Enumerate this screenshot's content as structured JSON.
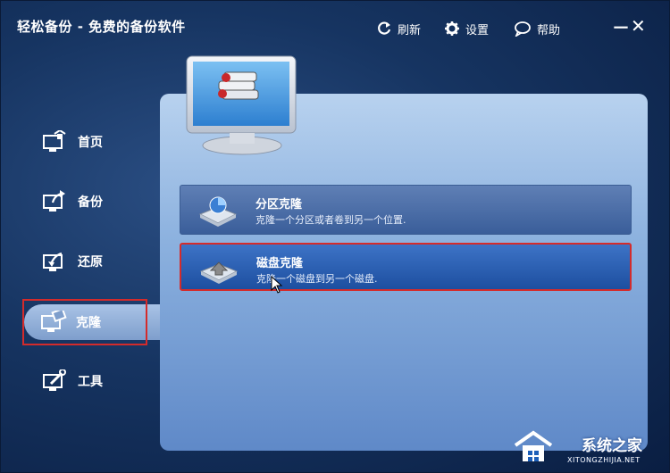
{
  "window": {
    "title": "轻松备份 - 免费的备份软件",
    "minimize_label": "－",
    "close_label": "✕"
  },
  "toolbar": {
    "refresh_label": "刷新",
    "settings_label": "设置",
    "help_label": "帮助"
  },
  "sidebar": {
    "items": [
      {
        "label": "首页",
        "icon": "home-icon"
      },
      {
        "label": "备份",
        "icon": "backup-icon"
      },
      {
        "label": "还原",
        "icon": "restore-icon"
      },
      {
        "label": "克隆",
        "icon": "clone-icon",
        "active": true
      },
      {
        "label": "工具",
        "icon": "tools-icon"
      }
    ]
  },
  "main": {
    "options": [
      {
        "title": "分区克隆",
        "description": "克隆一个分区或者卷到另一个位置.",
        "icon": "partition-clone-icon"
      },
      {
        "title": "磁盘克隆",
        "description": "克隆一个磁盘到另一个磁盘.",
        "icon": "disk-clone-icon",
        "selected": true
      }
    ]
  },
  "watermark": {
    "text": "系统之家",
    "sub": "XITONGZHIJIA.NET"
  },
  "colors": {
    "highlight_border": "#d42b2b",
    "panel_light": "#b8d2ef",
    "panel_dark": "#5f89c8",
    "background": "#163461"
  }
}
